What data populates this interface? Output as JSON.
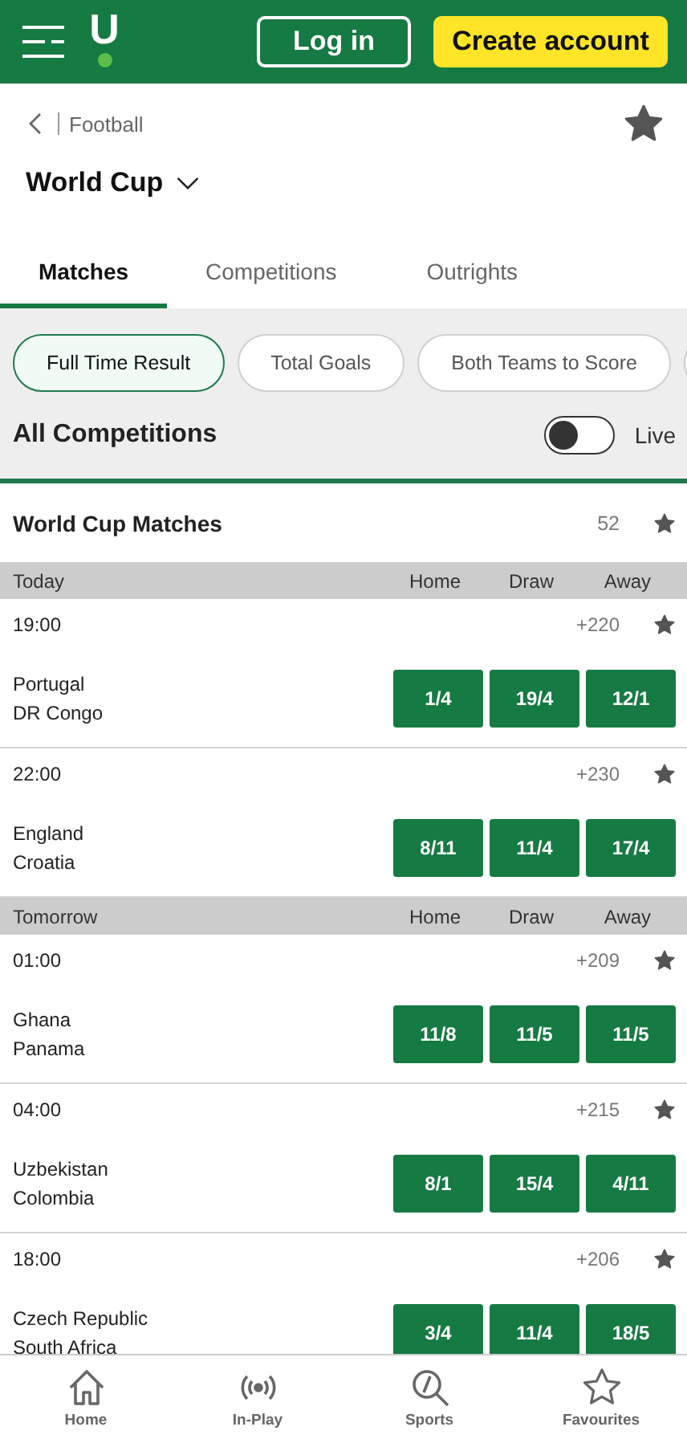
{
  "header": {
    "logo": "U",
    "login": "Log in",
    "create_account": "Create account"
  },
  "breadcrumb": {
    "label": "Football"
  },
  "title": "World Cup",
  "tabs": [
    {
      "label": "Matches",
      "selected": true
    },
    {
      "label": "Competitions",
      "selected": false
    },
    {
      "label": "Outrights",
      "selected": false
    }
  ],
  "filters": [
    {
      "label": "Full Time Result",
      "selected": true
    },
    {
      "label": "Total Goals",
      "selected": false
    },
    {
      "label": "Both Teams to Score",
      "selected": false
    }
  ],
  "competitions": {
    "label": "All Competitions",
    "live": {
      "label": "Live",
      "on": false
    }
  },
  "section": {
    "title": "World Cup Matches",
    "count": "52"
  },
  "days": [
    {
      "label": "Today",
      "columns": [
        "Home",
        "Draw",
        "Away"
      ],
      "matches": [
        {
          "time": "19:00",
          "markets": "+220",
          "home": "Portugal",
          "away": "DR Congo",
          "odds": [
            "1/4",
            "19/4",
            "12/1"
          ]
        },
        {
          "time": "22:00",
          "markets": "+230",
          "home": "England",
          "away": "Croatia",
          "odds": [
            "8/11",
            "11/4",
            "17/4"
          ]
        }
      ]
    },
    {
      "label": "Tomorrow",
      "columns": [
        "Home",
        "Draw",
        "Away"
      ],
      "matches": [
        {
          "time": "01:00",
          "markets": "+209",
          "home": "Ghana",
          "away": "Panama",
          "odds": [
            "11/8",
            "11/5",
            "11/5"
          ]
        },
        {
          "time": "04:00",
          "markets": "+215",
          "home": "Uzbekistan",
          "away": "Colombia",
          "odds": [
            "8/1",
            "15/4",
            "4/11"
          ]
        },
        {
          "time": "18:00",
          "markets": "+206",
          "home": "Czech Republic",
          "away": "South Africa",
          "odds": [
            "3/4",
            "11/4",
            "18/5"
          ]
        }
      ]
    }
  ],
  "nav": [
    {
      "label": "Home",
      "kind": "home"
    },
    {
      "label": "In-Play",
      "kind": "inplay"
    },
    {
      "label": "Sports",
      "kind": "sports"
    },
    {
      "label": "Favourites",
      "kind": "favourites"
    }
  ]
}
